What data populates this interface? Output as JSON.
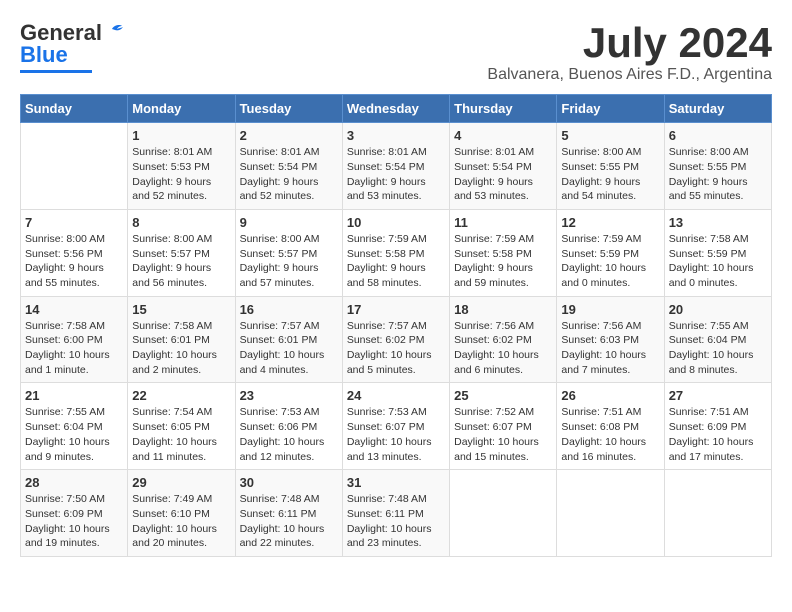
{
  "logo": {
    "line1": "General",
    "line2": "Blue"
  },
  "header": {
    "month": "July 2024",
    "location": "Balvanera, Buenos Aires F.D., Argentina"
  },
  "days_of_week": [
    "Sunday",
    "Monday",
    "Tuesday",
    "Wednesday",
    "Thursday",
    "Friday",
    "Saturday"
  ],
  "weeks": [
    [
      {
        "num": "",
        "sunrise": "",
        "sunset": "",
        "daylight": ""
      },
      {
        "num": "1",
        "sunrise": "Sunrise: 8:01 AM",
        "sunset": "Sunset: 5:53 PM",
        "daylight": "Daylight: 9 hours and 52 minutes."
      },
      {
        "num": "2",
        "sunrise": "Sunrise: 8:01 AM",
        "sunset": "Sunset: 5:54 PM",
        "daylight": "Daylight: 9 hours and 52 minutes."
      },
      {
        "num": "3",
        "sunrise": "Sunrise: 8:01 AM",
        "sunset": "Sunset: 5:54 PM",
        "daylight": "Daylight: 9 hours and 53 minutes."
      },
      {
        "num": "4",
        "sunrise": "Sunrise: 8:01 AM",
        "sunset": "Sunset: 5:54 PM",
        "daylight": "Daylight: 9 hours and 53 minutes."
      },
      {
        "num": "5",
        "sunrise": "Sunrise: 8:00 AM",
        "sunset": "Sunset: 5:55 PM",
        "daylight": "Daylight: 9 hours and 54 minutes."
      },
      {
        "num": "6",
        "sunrise": "Sunrise: 8:00 AM",
        "sunset": "Sunset: 5:55 PM",
        "daylight": "Daylight: 9 hours and 55 minutes."
      }
    ],
    [
      {
        "num": "7",
        "sunrise": "Sunrise: 8:00 AM",
        "sunset": "Sunset: 5:56 PM",
        "daylight": "Daylight: 9 hours and 55 minutes."
      },
      {
        "num": "8",
        "sunrise": "Sunrise: 8:00 AM",
        "sunset": "Sunset: 5:57 PM",
        "daylight": "Daylight: 9 hours and 56 minutes."
      },
      {
        "num": "9",
        "sunrise": "Sunrise: 8:00 AM",
        "sunset": "Sunset: 5:57 PM",
        "daylight": "Daylight: 9 hours and 57 minutes."
      },
      {
        "num": "10",
        "sunrise": "Sunrise: 7:59 AM",
        "sunset": "Sunset: 5:58 PM",
        "daylight": "Daylight: 9 hours and 58 minutes."
      },
      {
        "num": "11",
        "sunrise": "Sunrise: 7:59 AM",
        "sunset": "Sunset: 5:58 PM",
        "daylight": "Daylight: 9 hours and 59 minutes."
      },
      {
        "num": "12",
        "sunrise": "Sunrise: 7:59 AM",
        "sunset": "Sunset: 5:59 PM",
        "daylight": "Daylight: 10 hours and 0 minutes."
      },
      {
        "num": "13",
        "sunrise": "Sunrise: 7:58 AM",
        "sunset": "Sunset: 5:59 PM",
        "daylight": "Daylight: 10 hours and 0 minutes."
      }
    ],
    [
      {
        "num": "14",
        "sunrise": "Sunrise: 7:58 AM",
        "sunset": "Sunset: 6:00 PM",
        "daylight": "Daylight: 10 hours and 1 minute."
      },
      {
        "num": "15",
        "sunrise": "Sunrise: 7:58 AM",
        "sunset": "Sunset: 6:01 PM",
        "daylight": "Daylight: 10 hours and 2 minutes."
      },
      {
        "num": "16",
        "sunrise": "Sunrise: 7:57 AM",
        "sunset": "Sunset: 6:01 PM",
        "daylight": "Daylight: 10 hours and 4 minutes."
      },
      {
        "num": "17",
        "sunrise": "Sunrise: 7:57 AM",
        "sunset": "Sunset: 6:02 PM",
        "daylight": "Daylight: 10 hours and 5 minutes."
      },
      {
        "num": "18",
        "sunrise": "Sunrise: 7:56 AM",
        "sunset": "Sunset: 6:02 PM",
        "daylight": "Daylight: 10 hours and 6 minutes."
      },
      {
        "num": "19",
        "sunrise": "Sunrise: 7:56 AM",
        "sunset": "Sunset: 6:03 PM",
        "daylight": "Daylight: 10 hours and 7 minutes."
      },
      {
        "num": "20",
        "sunrise": "Sunrise: 7:55 AM",
        "sunset": "Sunset: 6:04 PM",
        "daylight": "Daylight: 10 hours and 8 minutes."
      }
    ],
    [
      {
        "num": "21",
        "sunrise": "Sunrise: 7:55 AM",
        "sunset": "Sunset: 6:04 PM",
        "daylight": "Daylight: 10 hours and 9 minutes."
      },
      {
        "num": "22",
        "sunrise": "Sunrise: 7:54 AM",
        "sunset": "Sunset: 6:05 PM",
        "daylight": "Daylight: 10 hours and 11 minutes."
      },
      {
        "num": "23",
        "sunrise": "Sunrise: 7:53 AM",
        "sunset": "Sunset: 6:06 PM",
        "daylight": "Daylight: 10 hours and 12 minutes."
      },
      {
        "num": "24",
        "sunrise": "Sunrise: 7:53 AM",
        "sunset": "Sunset: 6:07 PM",
        "daylight": "Daylight: 10 hours and 13 minutes."
      },
      {
        "num": "25",
        "sunrise": "Sunrise: 7:52 AM",
        "sunset": "Sunset: 6:07 PM",
        "daylight": "Daylight: 10 hours and 15 minutes."
      },
      {
        "num": "26",
        "sunrise": "Sunrise: 7:51 AM",
        "sunset": "Sunset: 6:08 PM",
        "daylight": "Daylight: 10 hours and 16 minutes."
      },
      {
        "num": "27",
        "sunrise": "Sunrise: 7:51 AM",
        "sunset": "Sunset: 6:09 PM",
        "daylight": "Daylight: 10 hours and 17 minutes."
      }
    ],
    [
      {
        "num": "28",
        "sunrise": "Sunrise: 7:50 AM",
        "sunset": "Sunset: 6:09 PM",
        "daylight": "Daylight: 10 hours and 19 minutes."
      },
      {
        "num": "29",
        "sunrise": "Sunrise: 7:49 AM",
        "sunset": "Sunset: 6:10 PM",
        "daylight": "Daylight: 10 hours and 20 minutes."
      },
      {
        "num": "30",
        "sunrise": "Sunrise: 7:48 AM",
        "sunset": "Sunset: 6:11 PM",
        "daylight": "Daylight: 10 hours and 22 minutes."
      },
      {
        "num": "31",
        "sunrise": "Sunrise: 7:48 AM",
        "sunset": "Sunset: 6:11 PM",
        "daylight": "Daylight: 10 hours and 23 minutes."
      },
      {
        "num": "",
        "sunrise": "",
        "sunset": "",
        "daylight": ""
      },
      {
        "num": "",
        "sunrise": "",
        "sunset": "",
        "daylight": ""
      },
      {
        "num": "",
        "sunrise": "",
        "sunset": "",
        "daylight": ""
      }
    ]
  ]
}
